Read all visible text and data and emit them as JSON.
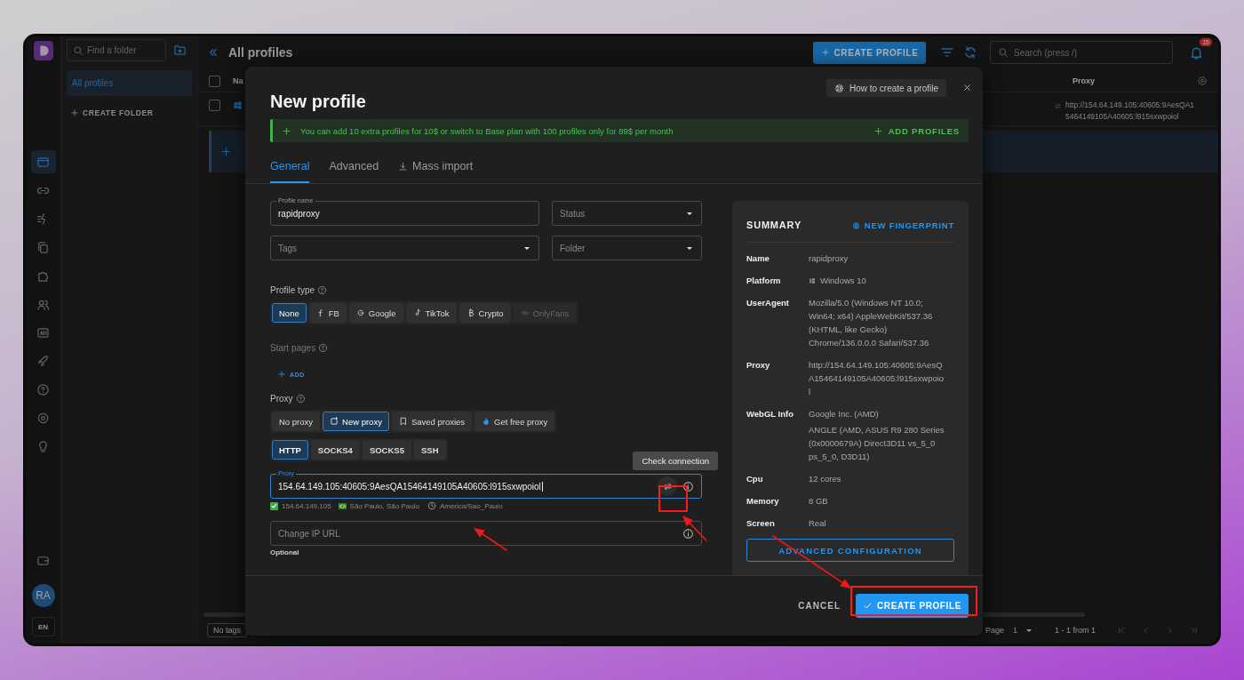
{
  "rail": [
    {
      "kind": "browser",
      "selected": true
    },
    {
      "kind": "link",
      "selected": false
    },
    {
      "kind": "automation",
      "selected": false
    },
    {
      "kind": "copy",
      "selected": false
    },
    {
      "kind": "puzzle",
      "selected": false
    },
    {
      "kind": "users",
      "selected": false
    },
    {
      "kind": "api",
      "selected": false
    },
    {
      "kind": "rocket",
      "selected": false
    },
    {
      "kind": "help",
      "selected": false
    },
    {
      "kind": "settings",
      "selected": false
    },
    {
      "kind": "bulb",
      "selected": false
    }
  ],
  "user": {
    "initials": "RA",
    "language": "EN"
  },
  "folders": {
    "search_placeholder": "Find a folder",
    "items": [
      {
        "label": "All profiles",
        "selected": true
      }
    ],
    "create_label": "CREATE FOLDER"
  },
  "header": {
    "title": "All profiles",
    "create_button": "CREATE PROFILE",
    "search_placeholder": "Search (press /)",
    "notification_count": "15"
  },
  "table": {
    "select_all_checked": false,
    "columns": [
      "Na",
      "Proxy"
    ],
    "rows": [
      {
        "checked": false,
        "proxy_lines": [
          "http://154.64.149.105:40605:9AesQA1",
          "5464149105A40605:l915sxwpoiol"
        ]
      }
    ]
  },
  "footer": {
    "tag_filter": "No tags",
    "page_label": "Page",
    "page": "1",
    "range": "1 - 1 from 1"
  },
  "modal": {
    "title": "New profile",
    "help_button": "How to create a profile",
    "banner": {
      "text": "You can add 10 extra profiles for 10$ or switch to Base plan with 100 profiles only for 89$ per month",
      "action": "ADD PROFILES"
    },
    "tabs": [
      {
        "label": "General",
        "kind": "plain",
        "selected": true
      },
      {
        "label": "Advanced",
        "kind": "plain",
        "selected": false
      },
      {
        "label": "Mass import",
        "kind": "import",
        "selected": false
      }
    ],
    "profile_name": {
      "label": "Profile name",
      "value": "rapidproxy"
    },
    "status": {
      "placeholder": "Status"
    },
    "tags": {
      "placeholder": "Tags"
    },
    "folder": {
      "placeholder": "Folder"
    },
    "profile_type": {
      "label": "Profile type",
      "options": [
        {
          "label": "None",
          "kind": "none",
          "selected": true,
          "disabled": false
        },
        {
          "label": "FB",
          "kind": "fb",
          "selected": false,
          "disabled": false
        },
        {
          "label": "Google",
          "kind": "google",
          "selected": false,
          "disabled": false
        },
        {
          "label": "TikTok",
          "kind": "tiktok",
          "selected": false,
          "disabled": false
        },
        {
          "label": "Crypto",
          "kind": "crypto",
          "selected": false,
          "disabled": false
        },
        {
          "label": "OnlyFans",
          "kind": "onlyfans",
          "selected": false,
          "disabled": true
        }
      ]
    },
    "start_pages": {
      "label": "Start pages",
      "add_button": "ADD"
    },
    "proxy": {
      "label": "Proxy",
      "modes": [
        {
          "label": "No proxy",
          "kind": "none",
          "selected": false
        },
        {
          "label": "New proxy",
          "kind": "new",
          "selected": true
        },
        {
          "label": "Saved proxies",
          "kind": "saved",
          "selected": false
        },
        {
          "label": "Get free proxy",
          "kind": "free",
          "selected": false
        }
      ],
      "protocols": [
        {
          "label": "HTTP",
          "selected": true
        },
        {
          "label": "SOCKS4",
          "selected": false
        },
        {
          "label": "SOCKS5",
          "selected": false
        },
        {
          "label": "SSH",
          "selected": false
        }
      ],
      "field": {
        "label": "Proxy",
        "value": "154.64.149.105:40605:9AesQA15464149105A40605:l915sxwpoiol"
      },
      "tooltip": "Check connection",
      "check": {
        "ip": "154.64.149.105",
        "location": "São Paulo, São Paulo",
        "timezone": "America/Sao_Paulo"
      },
      "change_ip": {
        "placeholder": "Change IP URL",
        "hint": "Optional"
      }
    },
    "summary": {
      "title": "SUMMARY",
      "action": "NEW FINGERPRINT",
      "rows": [
        {
          "label": "Name",
          "kind": "text",
          "paragraphs": [
            [
              "rapidproxy"
            ]
          ]
        },
        {
          "label": "Platform",
          "kind": "windows",
          "paragraphs": [
            [
              "Windows 10"
            ]
          ]
        },
        {
          "label": "UserAgent",
          "kind": "text",
          "paragraphs": [
            [
              "Mozilla/5.0 (Windows NT 10.0;",
              "Win64; x64) AppleWebKit/537.36",
              "(KHTML, like Gecko)",
              "Chrome/136.0.0.0 Safari/537.36"
            ]
          ]
        },
        {
          "label": "Proxy",
          "kind": "text",
          "paragraphs": [
            [
              "http://154.64.149.105:40605:9AesQ",
              "A15464149105A40605:l915sxwpoio",
              "l"
            ]
          ]
        },
        {
          "label": "WebGL Info",
          "kind": "text",
          "paragraphs": [
            [
              "Google Inc. (AMD)"
            ],
            [
              "ANGLE (AMD, ASUS R9 280 Series",
              "(0x0000679A) Direct3D11 vs_5_0",
              "ps_5_0, D3D11)"
            ]
          ]
        },
        {
          "label": "Cpu",
          "kind": "text",
          "paragraphs": [
            [
              "12 cores"
            ]
          ]
        },
        {
          "label": "Memory",
          "kind": "text",
          "paragraphs": [
            [
              "8 GB"
            ]
          ]
        },
        {
          "label": "Screen",
          "kind": "text",
          "paragraphs": [
            [
              "Real"
            ]
          ]
        }
      ],
      "advanced_button": "ADVANCED CONFIGURATION"
    },
    "cancel": "CANCEL",
    "submit": "CREATE PROFILE"
  }
}
